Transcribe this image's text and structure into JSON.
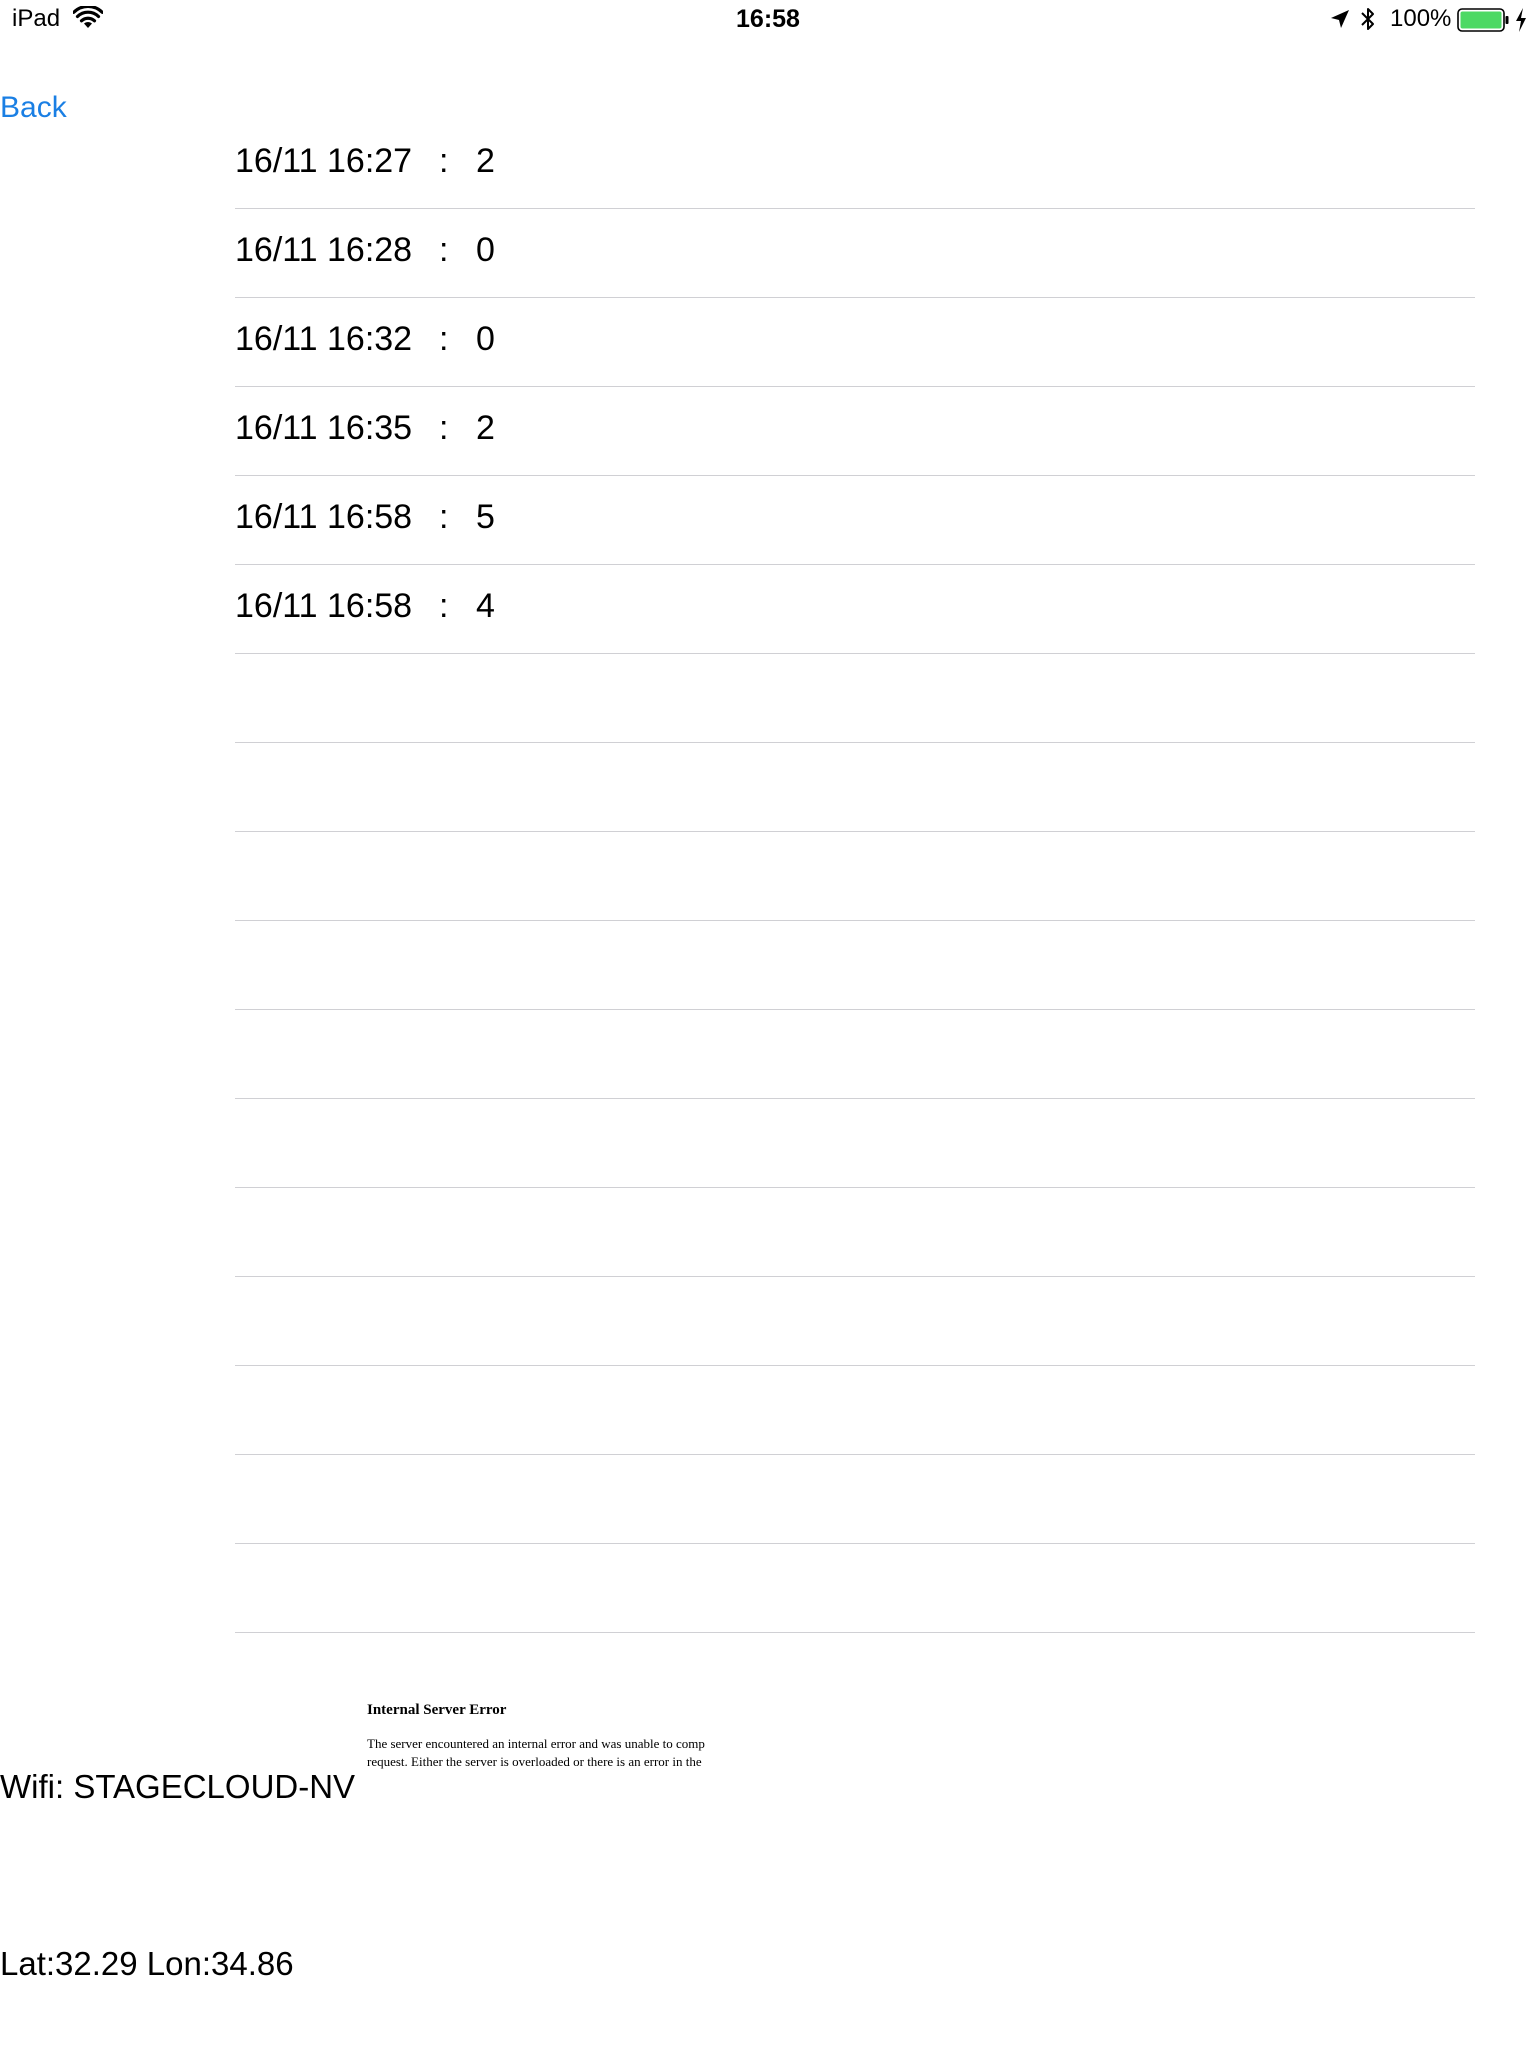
{
  "status_bar": {
    "device": "iPad",
    "clock": "16:58",
    "battery_percent": "100%",
    "battery_level": 1.0,
    "battery_color": "#4cd964",
    "icons": [
      "wifi-icon",
      "location-arrow-icon",
      "bluetooth-icon",
      "battery-icon",
      "charging-bolt-icon"
    ]
  },
  "nav": {
    "back_label": "Back",
    "accent_color": "#1a7fe4"
  },
  "history": {
    "separator": ":",
    "rows": [
      {
        "timestamp": "16/11 16:27",
        "value": "2"
      },
      {
        "timestamp": "16/11 16:28",
        "value": "0"
      },
      {
        "timestamp": "16/11 16:32",
        "value": "0"
      },
      {
        "timestamp": "16/11 16:35",
        "value": "2"
      },
      {
        "timestamp": "16/11 16:58",
        "value": "5"
      },
      {
        "timestamp": "16/11 16:58",
        "value": "4"
      },
      {
        "timestamp": "",
        "value": ""
      },
      {
        "timestamp": "",
        "value": ""
      },
      {
        "timestamp": "",
        "value": ""
      },
      {
        "timestamp": "",
        "value": ""
      },
      {
        "timestamp": "",
        "value": ""
      },
      {
        "timestamp": "",
        "value": ""
      },
      {
        "timestamp": "",
        "value": ""
      },
      {
        "timestamp": "",
        "value": ""
      },
      {
        "timestamp": "",
        "value": ""
      },
      {
        "timestamp": "",
        "value": ""
      },
      {
        "timestamp": "",
        "value": ""
      }
    ]
  },
  "error_view": {
    "title": "Internal Server Error",
    "body_line1": "The server encountered an internal error and was unable to comp",
    "body_line2": "request. Either the server is overloaded or there is an error in the"
  },
  "footer": {
    "wifi": "Wifi: STAGECLOUD-NV",
    "location": "Lat:32.29 Lon:34.86"
  }
}
